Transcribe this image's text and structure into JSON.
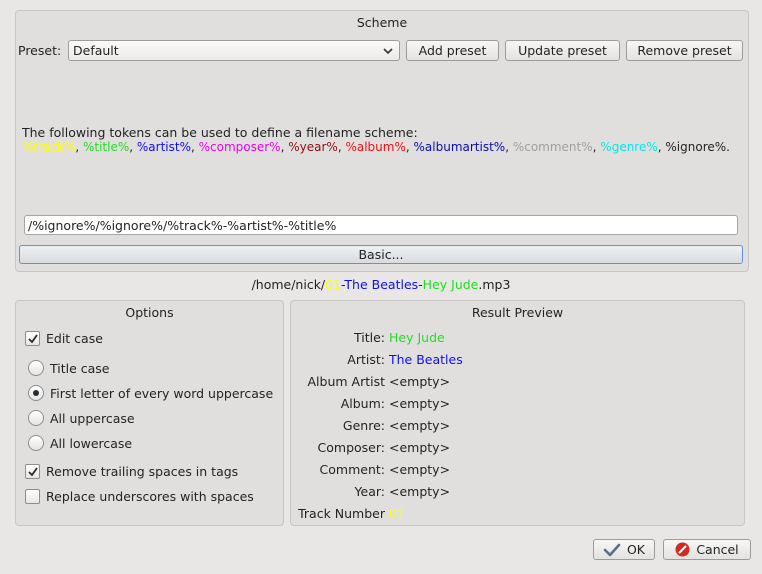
{
  "scheme": {
    "title": "Scheme",
    "preset_label": "Preset:",
    "preset_value": "Default",
    "add_preset": "Add preset",
    "update_preset": "Update preset",
    "remove_preset": "Remove preset",
    "tokens_intro": "The following tokens can be used to define a filename scheme:",
    "tokens": [
      {
        "text": "%track%",
        "color": "#ffff00"
      },
      {
        "text": "%title%",
        "color": "#22dd22"
      },
      {
        "text": "%artist%",
        "color": "#1010ee"
      },
      {
        "text": "%composer%",
        "color": "#ee00ee"
      },
      {
        "text": "%year%",
        "color": "#881111"
      },
      {
        "text": "%album%",
        "color": "#ee1111"
      },
      {
        "text": "%albumartist%",
        "color": "#0b0bb0"
      },
      {
        "text": "%comment%",
        "color": "#a0a0a0"
      },
      {
        "text": "%genre%",
        "color": "#00e8e8"
      },
      {
        "text": "%ignore%",
        "color": "#232323"
      }
    ],
    "separator": ",",
    "terminator": ".",
    "scheme_value": "/%ignore%/%ignore%/%track%-%artist%-%title%",
    "basic_button": "Basic..."
  },
  "filename_preview": {
    "segments": [
      {
        "text": "/home/nick/",
        "color": "#232323"
      },
      {
        "text": "01",
        "color": "#ffff00"
      },
      {
        "text": "-",
        "color": "#232323"
      },
      {
        "text": "The Beatles",
        "color": "#1010ee"
      },
      {
        "text": "-",
        "color": "#232323"
      },
      {
        "text": "Hey Jude",
        "color": "#22dd22"
      },
      {
        "text": ".mp3",
        "color": "#232323"
      }
    ]
  },
  "options": {
    "title": "Options",
    "edit_case": "Edit case",
    "title_case": "Title case",
    "first_letter": "First letter of every word uppercase",
    "all_uppercase": "All uppercase",
    "all_lowercase": "All lowercase",
    "remove_trailing": "Remove trailing spaces in tags",
    "replace_underscores": "Replace underscores with spaces"
  },
  "result": {
    "title": "Result Preview",
    "rows": [
      {
        "label": "Title:",
        "value": "Hey Jude",
        "color": "#22dd22"
      },
      {
        "label": "Artist:",
        "value": "The Beatles",
        "color": "#1010ee"
      },
      {
        "label": "Album Artist",
        "value": "<empty>",
        "color": "#232323"
      },
      {
        "label": "Album:",
        "value": "<empty>",
        "color": "#232323"
      },
      {
        "label": "Genre:",
        "value": "<empty>",
        "color": "#232323"
      },
      {
        "label": "Composer:",
        "value": "<empty>",
        "color": "#232323"
      },
      {
        "label": "Comment:",
        "value": "<empty>",
        "color": "#232323"
      },
      {
        "label": "Year:",
        "value": "<empty>",
        "color": "#232323"
      },
      {
        "label": "Track Number",
        "value": "01",
        "color": "#ffff00"
      }
    ]
  },
  "dialog": {
    "ok": "OK",
    "cancel": "Cancel"
  }
}
